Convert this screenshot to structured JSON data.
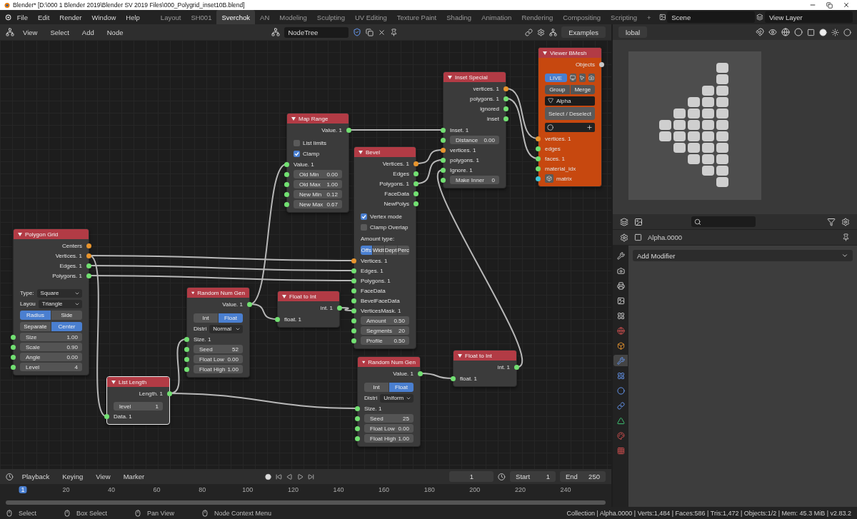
{
  "window": {
    "title": "Blender* [D:\\000 1 Blender 2019\\Blender SV 2019 Files\\000_Polygrid_inset10B.blend]"
  },
  "menu": [
    "File",
    "Edit",
    "Render",
    "Window",
    "Help"
  ],
  "workspaces": [
    {
      "label": "Layout",
      "selected": false
    },
    {
      "label": "SH001",
      "selected": false
    },
    {
      "label": "Sverchok",
      "selected": true
    },
    {
      "label": "AN",
      "selected": false
    },
    {
      "label": "Modeling",
      "selected": false
    },
    {
      "label": "Sculpting",
      "selected": false
    },
    {
      "label": "UV Editing",
      "selected": false
    },
    {
      "label": "Texture Paint",
      "selected": false
    },
    {
      "label": "Shading",
      "selected": false
    },
    {
      "label": "Animation",
      "selected": false
    },
    {
      "label": "Rendering",
      "selected": false
    },
    {
      "label": "Compositing",
      "selected": false
    },
    {
      "label": "Scripting",
      "selected": false
    }
  ],
  "add_workspace": "+",
  "scene": "Scene",
  "view_layer": "View Layer",
  "node_header": {
    "menus": [
      "View",
      "Select",
      "Add",
      "Node"
    ],
    "tree_name": "NodeTree",
    "examples": "Examples"
  },
  "viewport_header": {
    "orientation": "lobal"
  },
  "nodes": [
    {
      "title": "Polygon Grid",
      "kind": "standard",
      "selected": false,
      "rows": [
        {
          "kind": "output",
          "label": "Centers",
          "color": "#e8952e"
        },
        {
          "kind": "output",
          "label": "Vertices. 1",
          "color": "#e8952e"
        },
        {
          "kind": "output",
          "label": "Edges. 1",
          "color": "#72e072"
        },
        {
          "kind": "output",
          "label": "Polygons. 1",
          "color": "#72e072"
        },
        {
          "kind": "dropdown",
          "label": "Type:",
          "value": "Square"
        },
        {
          "kind": "dropdown",
          "label": "Layou",
          "value": "Triangle"
        },
        {
          "kind": "toggle",
          "options": [
            {
              "label": "Radius",
              "selected": true
            },
            {
              "label": "Side",
              "selected": false
            }
          ]
        },
        {
          "kind": "toggle",
          "options": [
            {
              "label": "Separate",
              "selected": false
            },
            {
              "label": "Center",
              "selected": true
            }
          ]
        },
        {
          "kind": "field",
          "label": "Size",
          "value": "1.00",
          "color": "#72e072"
        },
        {
          "kind": "field",
          "label": "Scale",
          "value": "0.90",
          "color": "#72e072"
        },
        {
          "kind": "field",
          "label": "Angle",
          "value": "0.00",
          "color": "#72e072"
        },
        {
          "kind": "field",
          "label": "Level",
          "value": "4",
          "color": "#72e072"
        }
      ]
    },
    {
      "title": "List Length",
      "kind": "standard",
      "selected": true,
      "rows": [
        {
          "kind": "output",
          "label": "Length. 1",
          "color": "#72e072"
        },
        {
          "kind": "field",
          "label": "level",
          "value": "1"
        },
        {
          "kind": "input",
          "label": "Data. 1",
          "color": "#72e072"
        }
      ]
    },
    {
      "title": "Random Num Gen",
      "kind": "standard",
      "selected": false,
      "rows": [
        {
          "kind": "output",
          "label": "Value. 1",
          "color": "#72e072"
        },
        {
          "kind": "toggle",
          "options": [
            {
              "label": "Int",
              "selected": false
            },
            {
              "label": "Float",
              "selected": true
            }
          ]
        },
        {
          "kind": "dropdown",
          "label": "Distri",
          "value": "Normal"
        },
        {
          "kind": "input",
          "label": "Size. 1",
          "color": "#72e072"
        },
        {
          "kind": "field",
          "label": "Seed",
          "value": "52",
          "color": "#72e072"
        },
        {
          "kind": "field",
          "label": "Float Low",
          "value": "0.00",
          "color": "#72e072"
        },
        {
          "kind": "field",
          "label": "Float High",
          "value": "1.00",
          "color": "#72e072"
        }
      ]
    },
    {
      "title": "Map Range",
      "kind": "standard",
      "selected": false,
      "rows": [
        {
          "kind": "output",
          "label": "Value. 1",
          "color": "#72e072"
        },
        {
          "kind": "checkbox",
          "label": "List limits",
          "checked": false
        },
        {
          "kind": "checkbox",
          "label": "Clamp",
          "checked": true
        },
        {
          "kind": "input",
          "label": "Value. 1",
          "color": "#72e072"
        },
        {
          "kind": "field",
          "label": "Old Min",
          "value": "0.00",
          "color": "#72e072"
        },
        {
          "kind": "field",
          "label": "Old Max",
          "value": "1.00",
          "color": "#72e072"
        },
        {
          "kind": "field",
          "label": "New Min",
          "value": "0.12",
          "color": "#72e072"
        },
        {
          "kind": "field",
          "label": "New Max",
          "value": "0.67",
          "color": "#72e072"
        }
      ]
    },
    {
      "title": "Float to Int",
      "kind": "standard",
      "selected": false,
      "rows": [
        {
          "kind": "output",
          "label": "int. 1",
          "color": "#72e072"
        },
        {
          "kind": "input",
          "label": "float. 1",
          "color": "#72e072"
        }
      ]
    },
    {
      "title": "Bevel",
      "kind": "standard",
      "selected": false,
      "rows": [
        {
          "kind": "output",
          "label": "Vertices. 1",
          "color": "#e8952e"
        },
        {
          "kind": "output",
          "label": "Edges",
          "color": "#72e072"
        },
        {
          "kind": "output",
          "label": "Polygons. 1",
          "color": "#72e072"
        },
        {
          "kind": "output",
          "label": "FaceData",
          "color": "#72e072"
        },
        {
          "kind": "output",
          "label": "NewPolys",
          "color": "#72e072"
        },
        {
          "kind": "checkbox",
          "label": "Vertex mode",
          "checked": true
        },
        {
          "kind": "checkbox",
          "label": "Clamp Overlap",
          "checked": false
        },
        {
          "kind": "label",
          "label": "Amount type:"
        },
        {
          "kind": "toggle",
          "options": [
            {
              "label": "Offs",
              "selected": true
            },
            {
              "label": "Widt",
              "selected": false
            },
            {
              "label": "Dept",
              "selected": false
            },
            {
              "label": "Perc",
              "selected": false
            }
          ]
        },
        {
          "kind": "input",
          "label": "Vertices. 1",
          "color": "#e8952e"
        },
        {
          "kind": "input",
          "label": "Edges. 1",
          "color": "#72e072"
        },
        {
          "kind": "input",
          "label": "Polygons. 1",
          "color": "#72e072"
        },
        {
          "kind": "input",
          "label": "FaceData",
          "color": "#72e072"
        },
        {
          "kind": "input",
          "label": "BevelFaceData",
          "color": "#72e072"
        },
        {
          "kind": "input",
          "label": "VerticesMask. 1",
          "color": "#72e072"
        },
        {
          "kind": "field",
          "label": "Amount",
          "value": "0.50",
          "color": "#72e072"
        },
        {
          "kind": "field",
          "label": "Segments",
          "value": "20",
          "color": "#72e072"
        },
        {
          "kind": "field",
          "label": "Profile",
          "value": "0.50",
          "color": "#72e072"
        }
      ]
    },
    {
      "title": "Inset Special",
      "kind": "standard",
      "selected": false,
      "rows": [
        {
          "kind": "output",
          "label": "vertices. 1",
          "color": "#e8952e"
        },
        {
          "kind": "output",
          "label": "polygons. 1",
          "color": "#72e072"
        },
        {
          "kind": "output",
          "label": "ignored",
          "color": "#72e072"
        },
        {
          "kind": "output",
          "label": "inset",
          "color": "#72e072"
        },
        {
          "kind": "input",
          "label": "Inset. 1",
          "color": "#72e072"
        },
        {
          "kind": "field",
          "label": "Distance",
          "value": "0.00",
          "color": "#72e072"
        },
        {
          "kind": "input",
          "label": "vertices. 1",
          "color": "#e8952e"
        },
        {
          "kind": "input",
          "label": "polygons. 1",
          "color": "#72e072"
        },
        {
          "kind": "input",
          "label": "Ignore. 1",
          "color": "#72e072"
        },
        {
          "kind": "field",
          "label": "Make Inner",
          "value": "0",
          "color": "#72e072"
        }
      ]
    },
    {
      "title": "Viewer BMesh",
      "kind": "viewer",
      "selected": false,
      "rows": [
        {
          "kind": "output",
          "label": "Objects",
          "color": "#c8c8c8"
        },
        {
          "kind": "live",
          "label": "LIVE",
          "on": true
        },
        {
          "kind": "toggle",
          "options": [
            {
              "label": "Group",
              "selected": false
            },
            {
              "label": "Merge",
              "selected": false
            }
          ]
        },
        {
          "kind": "object",
          "value": "Alpha"
        },
        {
          "kind": "button",
          "label": "Select / Deselect"
        },
        {
          "kind": "slot"
        },
        {
          "kind": "input",
          "label": "vertices. 1",
          "color": "#e8952e"
        },
        {
          "kind": "input",
          "label": "edges",
          "color": "#72e072"
        },
        {
          "kind": "input",
          "label": "faces. 1",
          "color": "#72e072"
        },
        {
          "kind": "input",
          "label": "material_idx",
          "color": "#72e072"
        },
        {
          "kind": "input_icon",
          "label": "matrix",
          "color": "#3fc5d8"
        }
      ]
    },
    {
      "title": "Random Num Gen",
      "kind": "standard",
      "selected": false,
      "rows": [
        {
          "kind": "output",
          "label": "Value. 1",
          "color": "#72e072"
        },
        {
          "kind": "toggle",
          "options": [
            {
              "label": "Int",
              "selected": false
            },
            {
              "label": "Float",
              "selected": true
            }
          ]
        },
        {
          "kind": "dropdown",
          "label": "Distri",
          "value": "Uniform"
        },
        {
          "kind": "input",
          "label": "Size. 1",
          "color": "#72e072"
        },
        {
          "kind": "field",
          "label": "Seed",
          "value": "25",
          "color": "#72e072"
        },
        {
          "kind": "field",
          "label": "Float Low",
          "value": "0.00",
          "color": "#72e072"
        },
        {
          "kind": "field",
          "label": "Float High",
          "value": "1.00",
          "color": "#72e072"
        }
      ]
    },
    {
      "title": "Float to Int",
      "kind": "standard",
      "selected": false,
      "rows": [
        {
          "kind": "output",
          "label": "int. 1",
          "color": "#72e072"
        },
        {
          "kind": "input",
          "label": "float. 1",
          "color": "#72e072"
        }
      ]
    }
  ],
  "properties": {
    "object_name": "Alpha.0000",
    "add_modifier": "Add Modifier",
    "tabs": [
      {
        "selected": false
      },
      {
        "selected": false
      },
      {
        "selected": false
      },
      {
        "selected": false
      },
      {
        "selected": false
      },
      {
        "selected": false
      },
      {
        "selected": false
      },
      {
        "selected": true
      },
      {
        "selected": false
      },
      {
        "selected": false
      },
      {
        "selected": false
      },
      {
        "selected": false
      },
      {
        "selected": false
      },
      {
        "selected": false
      }
    ]
  },
  "timeline": {
    "menus": [
      "Playback",
      "Keying",
      "View",
      "Marker"
    ],
    "current_frame": "1",
    "start_label": "Start",
    "start": "1",
    "end_label": "End",
    "end": "250",
    "ruler": [
      {
        "label": "1",
        "selected": true
      },
      {
        "label": "20",
        "selected": false
      },
      {
        "label": "40",
        "selected": false
      },
      {
        "label": "60",
        "selected": false
      },
      {
        "label": "80",
        "selected": false
      },
      {
        "label": "100",
        "selected": false
      },
      {
        "label": "120",
        "selected": false
      },
      {
        "label": "140",
        "selected": false
      },
      {
        "label": "160",
        "selected": false
      },
      {
        "label": "180",
        "selected": false
      },
      {
        "label": "200",
        "selected": false
      },
      {
        "label": "220",
        "selected": false
      },
      {
        "label": "240",
        "selected": false
      }
    ]
  },
  "status_bar": {
    "hints": [
      "Select",
      "Box Select",
      "Pan View",
      "Node Context Menu"
    ],
    "stats": "Collection | Alpha.0000 | Verts:1,484 | Faces:586 | Tris:1,472 | Objects:1/2 | Mem: 45.3 MiB | v2.83.2"
  }
}
